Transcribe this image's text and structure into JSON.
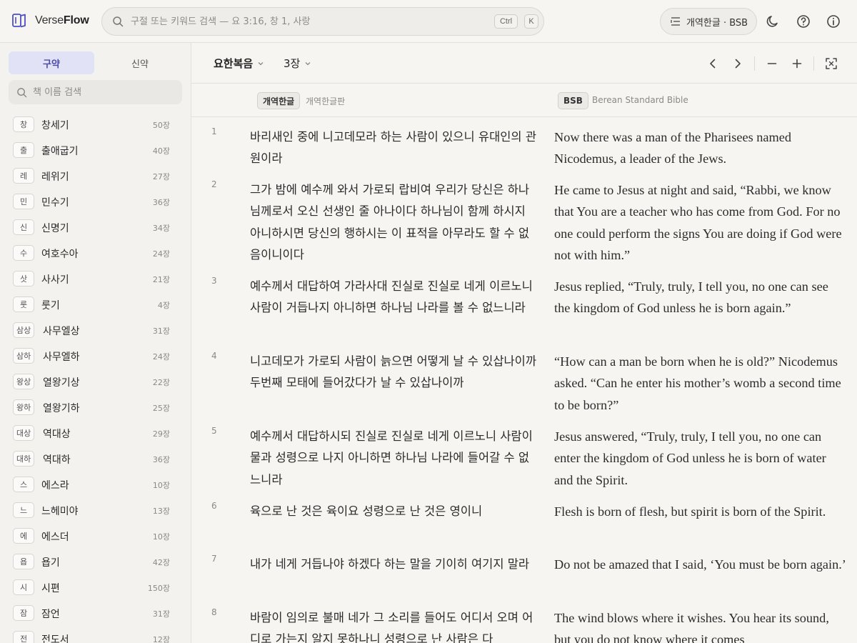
{
  "app": {
    "name_light": "Verse",
    "name_bold": "Flow"
  },
  "search": {
    "placeholder": "구절 또는 키워드 검색 — 요 3:16, 창 1, 사랑",
    "kbd_ctrl": "Ctrl",
    "kbd_k": "K"
  },
  "translation_button": {
    "label": "개역한글 · BSB"
  },
  "header_icons": [
    "theme-moon-icon",
    "help-icon",
    "info-icon"
  ],
  "sidebar": {
    "tabs": [
      {
        "label": "구약",
        "active": true
      },
      {
        "label": "신약",
        "active": false
      }
    ],
    "book_search_placeholder": "책 이름 검색",
    "books": [
      {
        "abbr": "창",
        "name": "창세기",
        "chapters": "50장"
      },
      {
        "abbr": "출",
        "name": "출애굽기",
        "chapters": "40장"
      },
      {
        "abbr": "레",
        "name": "레위기",
        "chapters": "27장"
      },
      {
        "abbr": "민",
        "name": "민수기",
        "chapters": "36장"
      },
      {
        "abbr": "신",
        "name": "신명기",
        "chapters": "34장"
      },
      {
        "abbr": "수",
        "name": "여호수아",
        "chapters": "24장"
      },
      {
        "abbr": "삿",
        "name": "사사기",
        "chapters": "21장"
      },
      {
        "abbr": "룻",
        "name": "룻기",
        "chapters": "4장"
      },
      {
        "abbr": "삼상",
        "name": "사무엘상",
        "chapters": "31장"
      },
      {
        "abbr": "삼하",
        "name": "사무엘하",
        "chapters": "24장"
      },
      {
        "abbr": "왕상",
        "name": "열왕기상",
        "chapters": "22장"
      },
      {
        "abbr": "왕하",
        "name": "열왕기하",
        "chapters": "25장"
      },
      {
        "abbr": "대상",
        "name": "역대상",
        "chapters": "29장"
      },
      {
        "abbr": "대하",
        "name": "역대하",
        "chapters": "36장"
      },
      {
        "abbr": "스",
        "name": "에스라",
        "chapters": "10장"
      },
      {
        "abbr": "느",
        "name": "느헤미야",
        "chapters": "13장"
      },
      {
        "abbr": "에",
        "name": "에스더",
        "chapters": "10장"
      },
      {
        "abbr": "욥",
        "name": "욥기",
        "chapters": "42장"
      },
      {
        "abbr": "시",
        "name": "시편",
        "chapters": "150장"
      },
      {
        "abbr": "잠",
        "name": "잠언",
        "chapters": "31장"
      },
      {
        "abbr": "전",
        "name": "전도서",
        "chapters": "12장"
      }
    ]
  },
  "toolbar": {
    "book": "요한복음",
    "chapter": "3장",
    "icons": [
      "prev-chapter-icon",
      "next-chapter-icon",
      "font-decrease-icon",
      "font-increase-icon",
      "fullscreen-icon"
    ]
  },
  "columns": [
    {
      "badge": "개역한글",
      "name": "개역한글판"
    },
    {
      "badge": "BSB",
      "name": "Berean Standard Bible"
    }
  ],
  "verses": [
    {
      "num": "1",
      "ko": "바리새인 중에 니고데모라 하는 사람이 있으니 유대인의 관원이라",
      "en": "Now there was a man of the Pharisees named Nicodemus, a leader of the Jews."
    },
    {
      "num": "2",
      "ko": "그가 밤에 예수께 와서 가로되 랍비여 우리가 당신은 하나님께로서 오신 선생인 줄 아나이다 하나님이 함께 하시지 아니하시면 당신의 행하시는 이 표적을 아무라도 할 수 없음이니이다",
      "en": "He came to Jesus at night and said, “Rabbi, we know that You are a teacher who has come from God. For no one could perform the signs You are doing if God were not with him.”"
    },
    {
      "num": "3",
      "ko": "예수께서 대답하여 가라사대 진실로 진실로 네게 이르노니 사람이 거듭나지 아니하면 하나님 나라를 볼 수 없느니라",
      "en": "Jesus replied, “Truly, truly, I tell you, no one can see the kingdom of God unless he is born again.”"
    },
    {
      "num": "4",
      "ko": "니고데모가 가로되 사람이 늙으면 어떻게 날 수 있삽나이까 두번째 모태에 들어갔다가 날 수 있삽나이까",
      "en": "“How can a man be born when he is old?” Nicodemus asked. “Can he enter his mother’s womb a second time to be born?”"
    },
    {
      "num": "5",
      "ko": "예수께서 대답하시되 진실로 진실로 네게 이르노니 사람이 물과 성령으로 나지 아니하면 하나님 나라에 들어갈 수 없느니라",
      "en": "Jesus answered, “Truly, truly, I tell you, no one can enter the kingdom of God unless he is born of water and the Spirit."
    },
    {
      "num": "6",
      "ko": "육으로 난 것은 육이요 성령으로 난 것은 영이니",
      "en": "Flesh is born of flesh, but spirit is born of the Spirit."
    },
    {
      "num": "7",
      "ko": "내가 네게 거듭나야 하겠다 하는 말을 기이히 여기지 말라",
      "en": "Do not be amazed that I said, ‘You must be born again.’"
    },
    {
      "num": "8",
      "ko": "바람이 임의로 불매 네가 그 소리를 들어도 어디서 오며 어디로 가는지 알지 못하나니 성령으로 난 사람은 다",
      "en": "The wind blows where it wishes. You hear its sound, but you do not know where it comes"
    }
  ]
}
